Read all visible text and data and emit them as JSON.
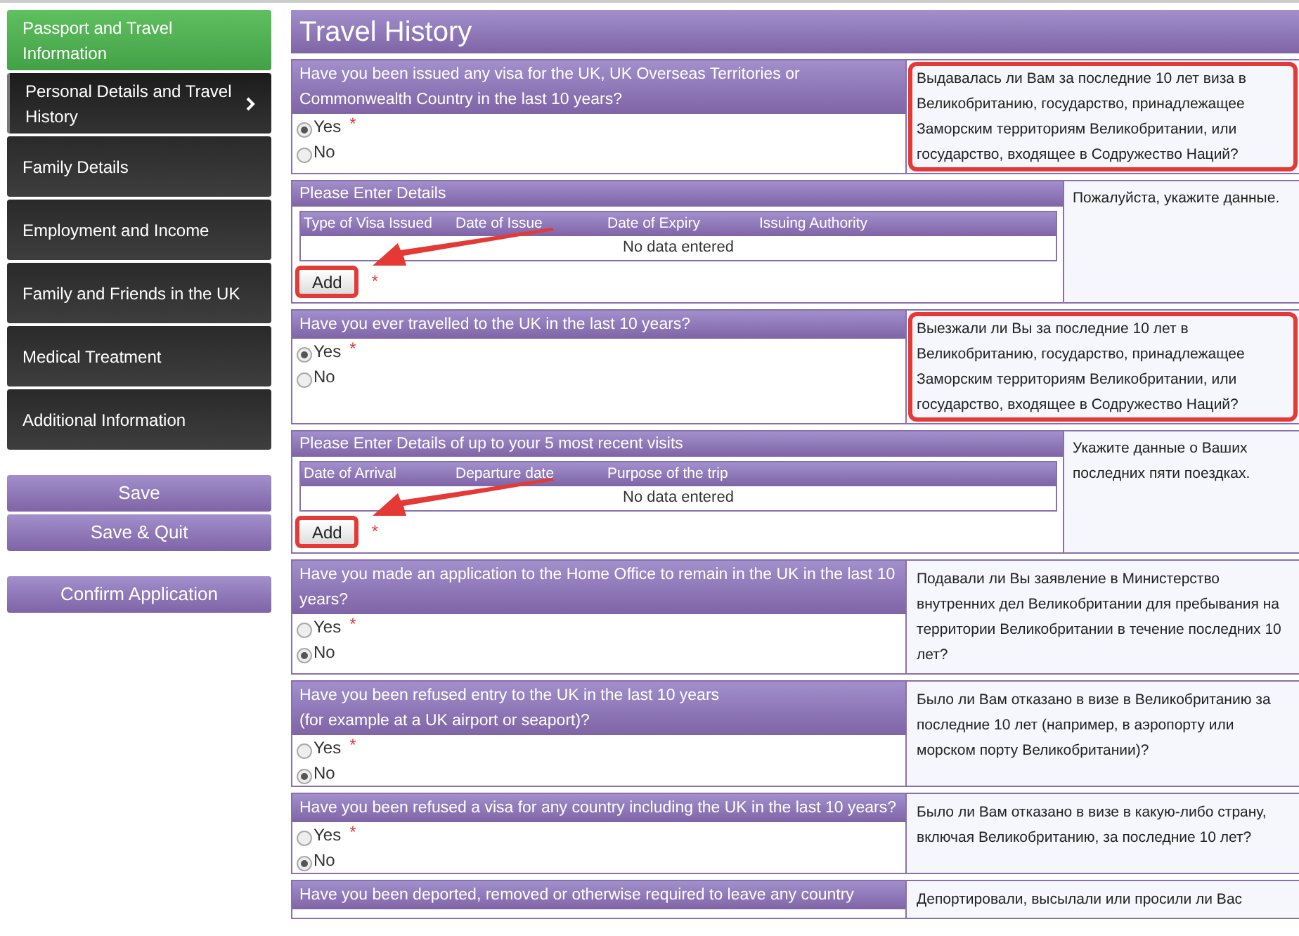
{
  "sidebar": {
    "items": [
      {
        "label": "Passport and Travel Information",
        "completed": true,
        "selected": false
      },
      {
        "label": "Personal Details and Travel History",
        "completed": false,
        "selected": true
      },
      {
        "label": "Family Details",
        "completed": false,
        "selected": false
      },
      {
        "label": "Employment and Income",
        "completed": false,
        "selected": false
      },
      {
        "label": "Family and Friends in the UK",
        "completed": false,
        "selected": false
      },
      {
        "label": "Medical Treatment",
        "completed": false,
        "selected": false
      },
      {
        "label": "Additional Information",
        "completed": false,
        "selected": false
      }
    ],
    "buttons": [
      "Save",
      "Save & Quit"
    ],
    "confirm_button": "Confirm Application"
  },
  "section_title": "Travel History",
  "blocks": [
    {
      "kind": "question",
      "question": "Have you been issued any visa for the UK, UK Overseas Territories or Commonwealth Country in the last 10 years?",
      "required_mark": "*",
      "options": [
        {
          "label": "Yes",
          "selected": true
        },
        {
          "label": "No",
          "selected": false
        }
      ],
      "translation": "Выдавалась ли Вам за последние 10 лет виза в Великобританию, государство, принадлежащее Заморским территориям Великобритании, или государство, входящее в Содружество Наций?",
      "highlighted": true
    },
    {
      "kind": "details",
      "title": "Please Enter Details",
      "columns": [
        "Type of Visa Issued",
        "Date of Issue",
        "Date of Expiry",
        "Issuing Authority"
      ],
      "empty_text": "No data entered",
      "button": "Add",
      "required_mark": "*",
      "translation": "Пожалуйста, укажите данные.",
      "annotated": true
    },
    {
      "kind": "question",
      "question": "Have you ever travelled to the UK in the last 10 years?",
      "required_mark": "*",
      "options": [
        {
          "label": "Yes",
          "selected": true
        },
        {
          "label": "No",
          "selected": false
        }
      ],
      "translation": "Выезжали ли Вы за последние 10 лет в Великобританию, государство, принадлежащее Заморским территориям Великобритании, или государство, входящее в Содружество Наций?",
      "highlighted": true
    },
    {
      "kind": "details",
      "title": "Please Enter Details of up to your 5 most recent visits",
      "columns": [
        "Date of Arrival",
        "Departure date",
        "Purpose of the trip"
      ],
      "empty_text": "No data entered",
      "button": "Add",
      "required_mark": "*",
      "translation": "Укажите данные о Ваших последних пяти поездках.",
      "annotated": true
    },
    {
      "kind": "question",
      "question": "Have you made an application to the Home Office to remain in the UK in the last 10 years?",
      "required_mark": "*",
      "options": [
        {
          "label": "Yes",
          "selected": false
        },
        {
          "label": "No",
          "selected": true
        }
      ],
      "translation": "Подавали ли Вы заявление в Министерство внутренних дел Великобритании для пребывания на территории Великобритании в течение последних 10 лет?",
      "highlighted": false
    },
    {
      "kind": "question",
      "question": "Have you been refused entry to the UK in the last 10 years\n(for example at a UK airport or seaport)?",
      "required_mark": "*",
      "options": [
        {
          "label": "Yes",
          "selected": false
        },
        {
          "label": "No",
          "selected": true
        }
      ],
      "translation": "Было ли Вам отказано в визе в Великобританию за последние 10 лет (например, в аэропорту или морском порту Великобритании)?",
      "highlighted": false
    },
    {
      "kind": "question",
      "question": "Have you been refused a visa for any country including the UK in the last 10 years?",
      "required_mark": "*",
      "options": [
        {
          "label": "Yes",
          "selected": false
        },
        {
          "label": "No",
          "selected": true
        }
      ],
      "translation": "Было ли Вам отказано в визе в какую-либо страну, включая Великобританию, за последние 10 лет?",
      "highlighted": false
    },
    {
      "kind": "question",
      "question": "Have you been deported, removed or otherwise required to leave any country",
      "translation": "Депортировали, высылали или просили ли Вас",
      "highlighted": false
    }
  ]
}
